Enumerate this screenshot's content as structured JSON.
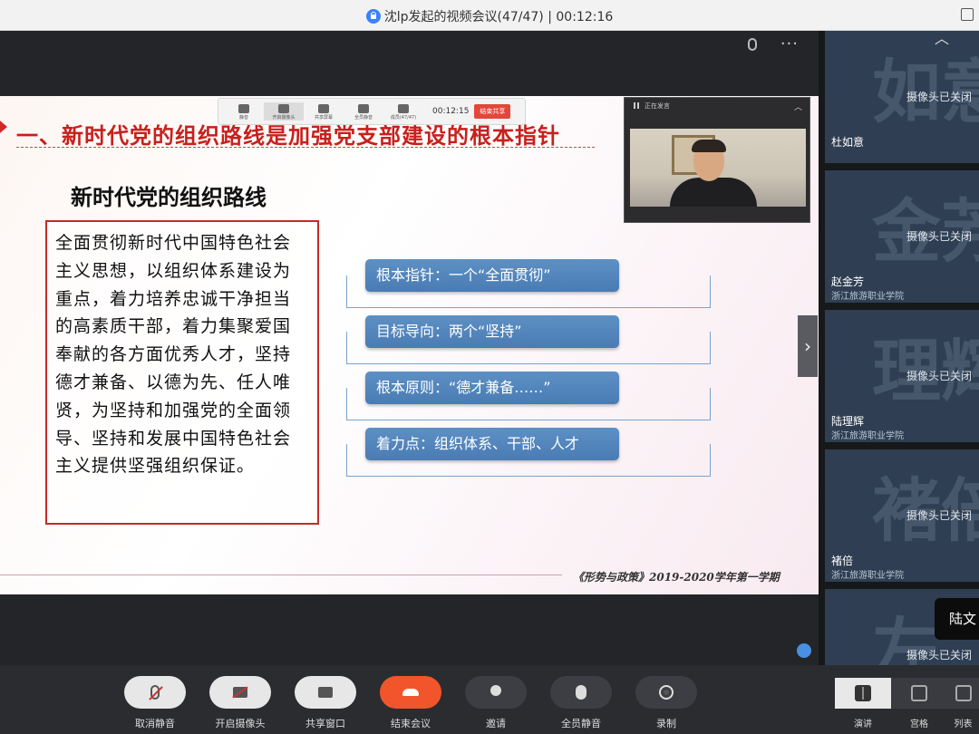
{
  "window": {
    "title": "沈lp发起的视频会议(47/47)",
    "elapsed": "00:12:16"
  },
  "slide": {
    "heading": "一、新时代党的组织路线是加强党支部建设的根本指针",
    "subheading": "新时代党的组织路线",
    "body_lines": [
      "全面贯彻新时代中国特色社会",
      "主义思想，以组织体系建设为",
      "重点，着力培养忠诚干净担当",
      "的高素质干部，着力集聚爱国",
      "奉献的各方面优秀人才，坚持",
      "德才兼备、以德为先、任人唯",
      "贤，为坚持和加强党的全面领",
      "导、坚持和发展中国特色社会",
      "主义提供坚强组织保证。"
    ],
    "points": [
      "根本指针：一个“全面贯彻”",
      "目标导向：两个“坚持”",
      "根本原则：“德才兼备……”",
      "着力点：组织体系、干部、人才"
    ],
    "footer": "《形势与政策》2019-2020学年第一学期"
  },
  "mini_toolbar": {
    "buttons": [
      "静音",
      "开启摄像头",
      "共享屏幕",
      "全员静音",
      "成员(47/47)"
    ],
    "timer": "00:12:15",
    "end_label": "结束共享"
  },
  "camera_window": {
    "status": "正在发言"
  },
  "participants": [
    {
      "big": "如意",
      "camera": "摄像头已关闭",
      "name": "杜如意",
      "org": ""
    },
    {
      "big": "金芳",
      "camera": "摄像头已关闭",
      "name": "赵金芳",
      "org": "浙江旅游职业学院"
    },
    {
      "big": "理辉",
      "camera": "摄像头已关闭",
      "name": "陆理辉",
      "org": "浙江旅游职业学院"
    },
    {
      "big": "褚倍",
      "camera": "摄像头已关闭",
      "name": "褚倍",
      "org": "浙江旅游职业学院"
    },
    {
      "big": "左",
      "camera": "摄像头已关闭",
      "name": "",
      "org": ""
    }
  ],
  "tooltip": "陆文",
  "controls": {
    "mute": "取消静音",
    "camera": "开启摄像头",
    "share": "共享窗口",
    "end": "结束会议",
    "invite": "邀请",
    "mute_all": "全员静音",
    "record": "录制"
  },
  "views": {
    "speaker": "演讲",
    "gallery": "宫格",
    "list": "列表"
  },
  "colors": {
    "end_button": "#f2552c",
    "slide_heading": "#c8201c",
    "pill_fill": "#4a7cb4",
    "tile_bg": "#2f3e52"
  }
}
